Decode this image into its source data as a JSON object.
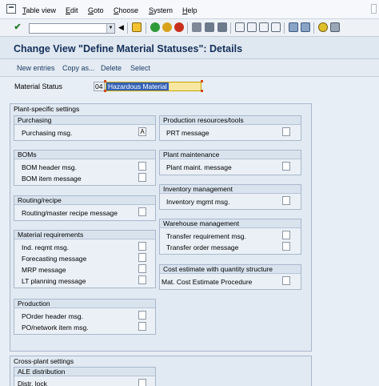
{
  "menu": [
    "Table view",
    "Edit",
    "Goto",
    "Choose",
    "System",
    "Help"
  ],
  "toolbar": {
    "command_field": "",
    "icons": [
      "enter-icon",
      "save-icon",
      "back-icon",
      "exit-icon",
      "cancel-icon",
      "print-icon",
      "find-icon",
      "find-next-icon",
      "first-page-icon",
      "previous-page-icon",
      "next-page-icon",
      "last-page-icon",
      "new-session-icon",
      "shortcut-icon",
      "help-icon",
      "layout-icon"
    ]
  },
  "title": "Change View \"Define Material Statuses\": Details",
  "app_toolbar": [
    "New entries",
    "Copy as...",
    "Delete",
    "Select"
  ],
  "material_status": {
    "label": "Material Status",
    "code": "04",
    "description": "Hazardous Material"
  },
  "plant_specific": {
    "title": "Plant-specific settings",
    "purchasing": {
      "title": "Purchasing",
      "rows": [
        {
          "label": "Purchasing msg.",
          "value": "A"
        }
      ]
    },
    "boms": {
      "title": "BOMs",
      "rows": [
        {
          "label": "BOM header msg.",
          "value": ""
        },
        {
          "label": "BOM item message",
          "value": ""
        }
      ]
    },
    "routing": {
      "title": "Routing/recipe",
      "rows": [
        {
          "label": "Routing/master recipe message",
          "value": ""
        }
      ]
    },
    "material_requirements": {
      "title": "Material requirements",
      "rows": [
        {
          "label": "Ind. reqmt msg.",
          "value": ""
        },
        {
          "label": "Forecasting message",
          "value": ""
        },
        {
          "label": "MRP message",
          "value": ""
        },
        {
          "label": "LT planning message",
          "value": ""
        }
      ]
    },
    "production": {
      "title": "Production",
      "rows": [
        {
          "label": "POrder header msg.",
          "value": ""
        },
        {
          "label": "PO/network item msg.",
          "value": ""
        }
      ]
    },
    "prt": {
      "title": "Production resources/tools",
      "rows": [
        {
          "label": "PRT message",
          "value": ""
        }
      ]
    },
    "plant_maintenance": {
      "title": "Plant maintenance",
      "rows": [
        {
          "label": "Plant maint. message",
          "value": ""
        }
      ]
    },
    "inventory": {
      "title": "Inventory management",
      "rows": [
        {
          "label": "Inventory mgmt msg.",
          "value": ""
        }
      ]
    },
    "warehouse": {
      "title": "Warehouse management",
      "rows": [
        {
          "label": "Transfer requirement msg.",
          "value": ""
        },
        {
          "label": "Transfer order message",
          "value": ""
        }
      ]
    },
    "cost_estimate": {
      "title": "Cost estimate with quantity structure",
      "rows": [
        {
          "label": "Mat. Cost Estimate Procedure",
          "value": ""
        }
      ]
    }
  },
  "cross_plant": {
    "title": "Cross-plant settings",
    "ale": {
      "title": "ALE distribution",
      "rows": [
        {
          "label": "Distr. lock",
          "value": ""
        }
      ]
    }
  }
}
